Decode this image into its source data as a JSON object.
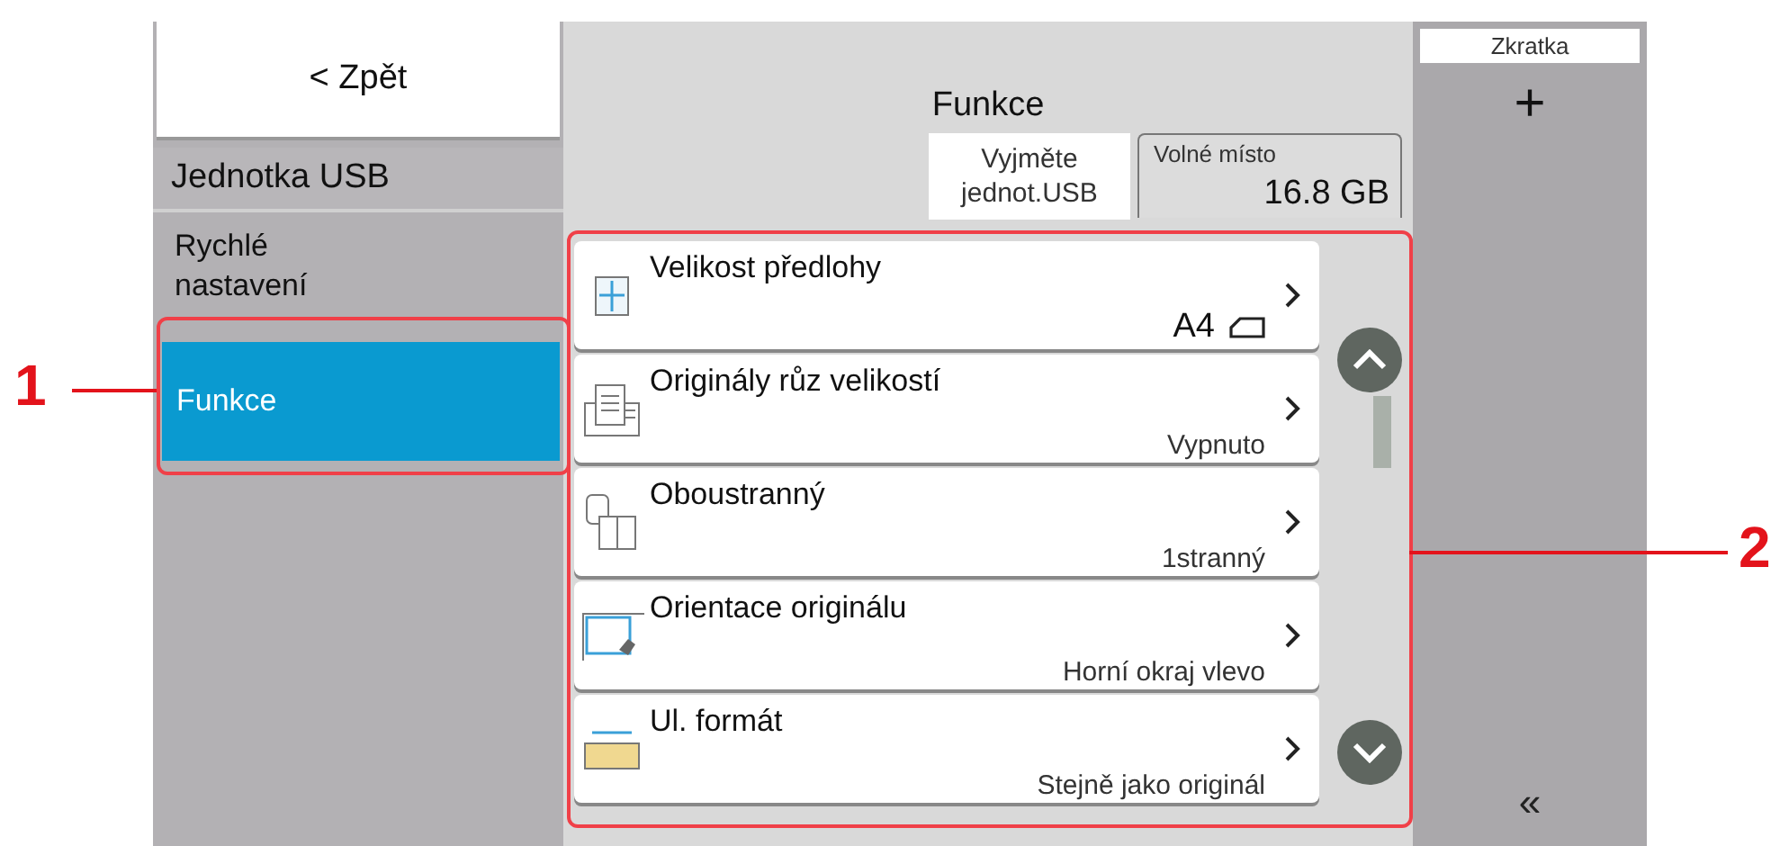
{
  "back_button": {
    "label": "< Zpět"
  },
  "sidebar": {
    "title": "Jednotka USB",
    "items": [
      {
        "label": "Rychlé nastavení",
        "selected": false
      },
      {
        "label": "Funkce",
        "selected": true
      }
    ]
  },
  "header": {
    "title": "Funkce"
  },
  "eject_button": {
    "label": "Vyjměte jednot.USB"
  },
  "free_space": {
    "label": "Volné místo",
    "value": "16.8 GB"
  },
  "functions": [
    {
      "label": "Velikost předlohy",
      "value": "A4",
      "kind": "size"
    },
    {
      "label": "Originály růz velikostí",
      "value": "Vypnuto",
      "kind": "mixed"
    },
    {
      "label": "Oboustranný",
      "value": "1stranný",
      "kind": "duplex"
    },
    {
      "label": "Orientace originálu",
      "value": "Horní okraj vlevo",
      "kind": "orientation"
    },
    {
      "label": "Ul. formát",
      "value": "Stejně jako originál",
      "kind": "format"
    }
  ],
  "shortcut": {
    "label": "Zkratka",
    "add": "+",
    "collapse": "«"
  },
  "callouts": [
    {
      "number": "1"
    },
    {
      "number": "2"
    }
  ]
}
